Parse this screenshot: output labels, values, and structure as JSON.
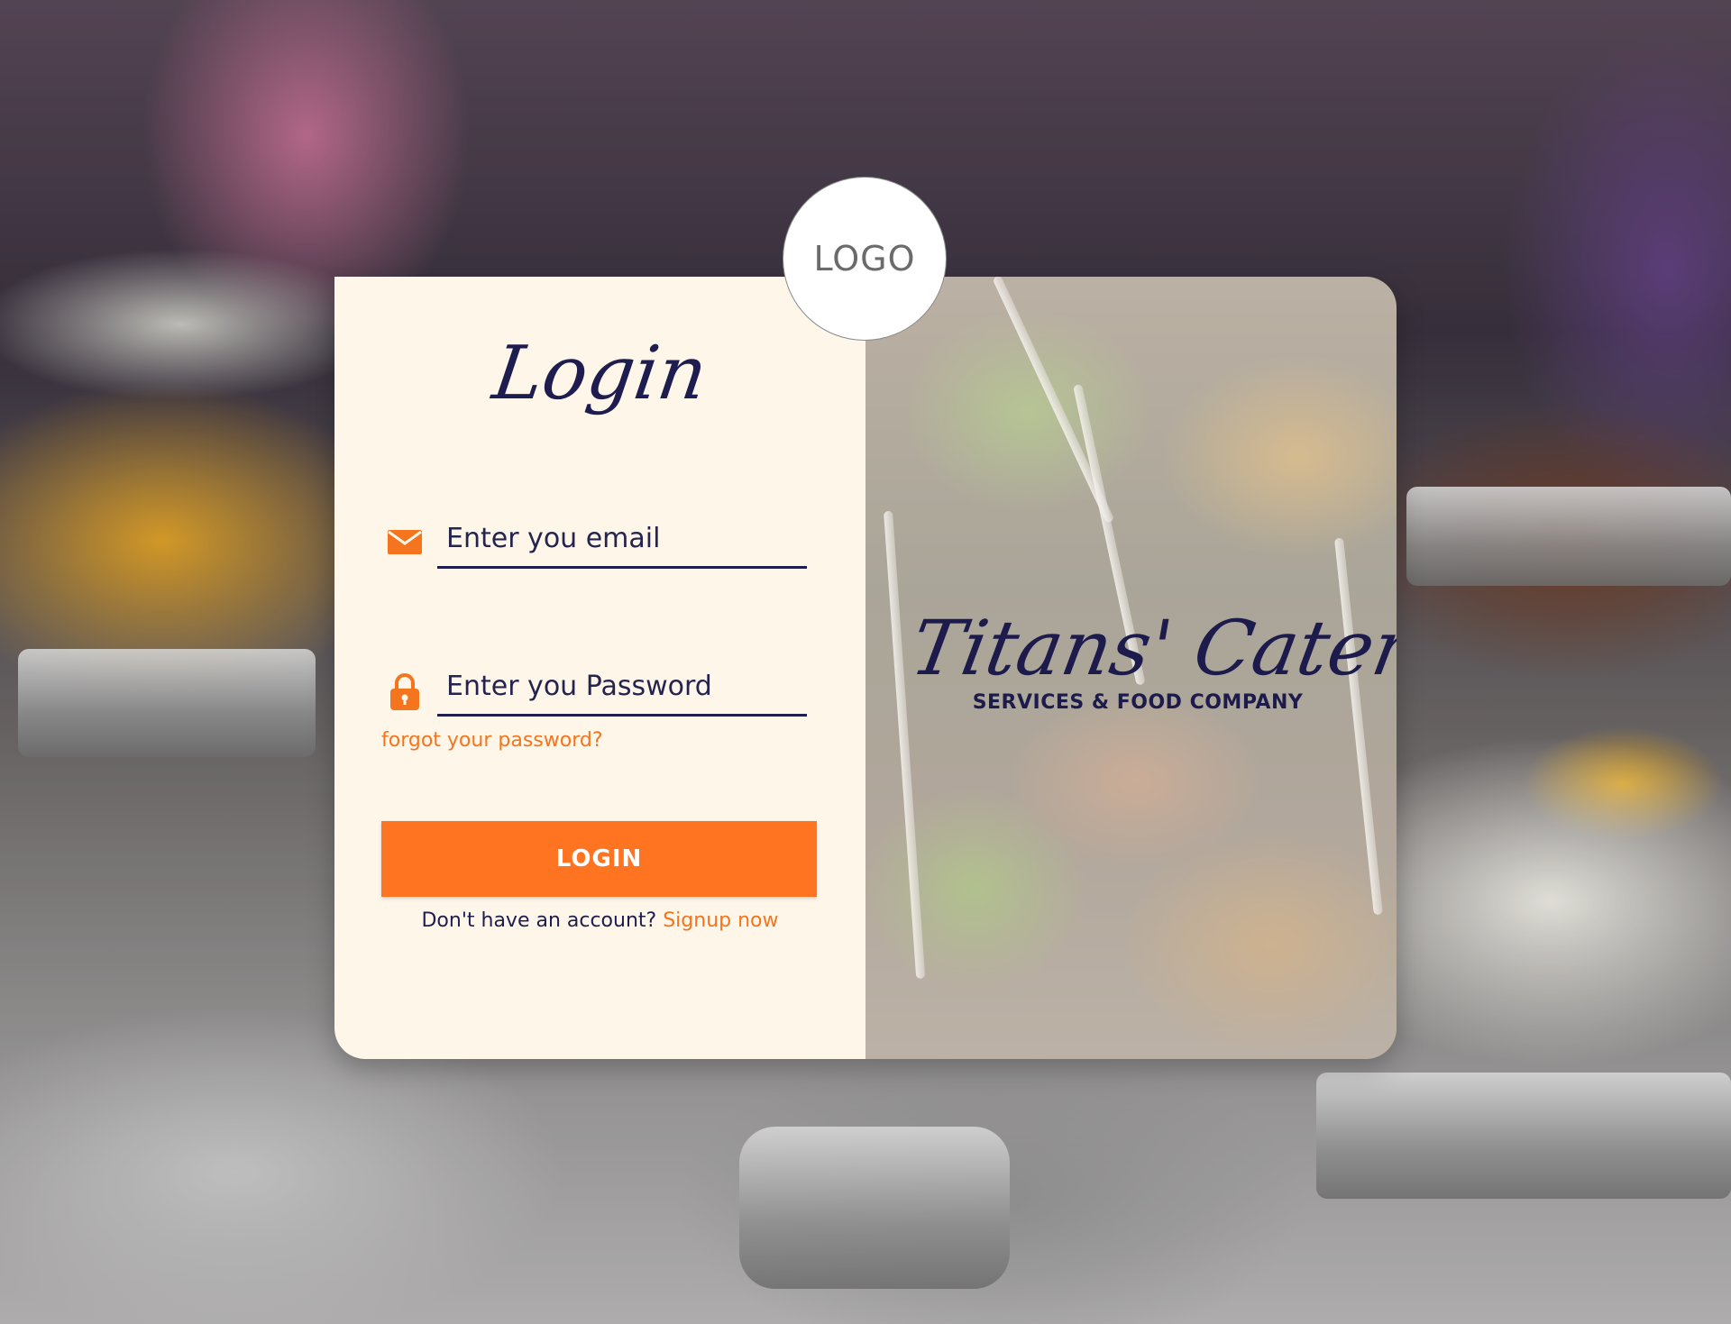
{
  "logo": {
    "text": "LOGO"
  },
  "login": {
    "title": "Login",
    "email": {
      "placeholder": "Enter you email",
      "value": "",
      "icon": "envelope-icon"
    },
    "password": {
      "placeholder": "Enter you Password",
      "value": "",
      "icon": "lock-icon"
    },
    "forgot_label": "forgot your password?",
    "button_label": "LOGIN",
    "signup_prompt": "Don't have an account?",
    "signup_link": "Signup now"
  },
  "brand": {
    "name": "Titans' Catering",
    "tagline": "SERVICES & FOOD COMPANY"
  },
  "colors": {
    "accent": "#ff7420",
    "navy": "#1e1d4f",
    "card_bg": "#fef6e9"
  }
}
